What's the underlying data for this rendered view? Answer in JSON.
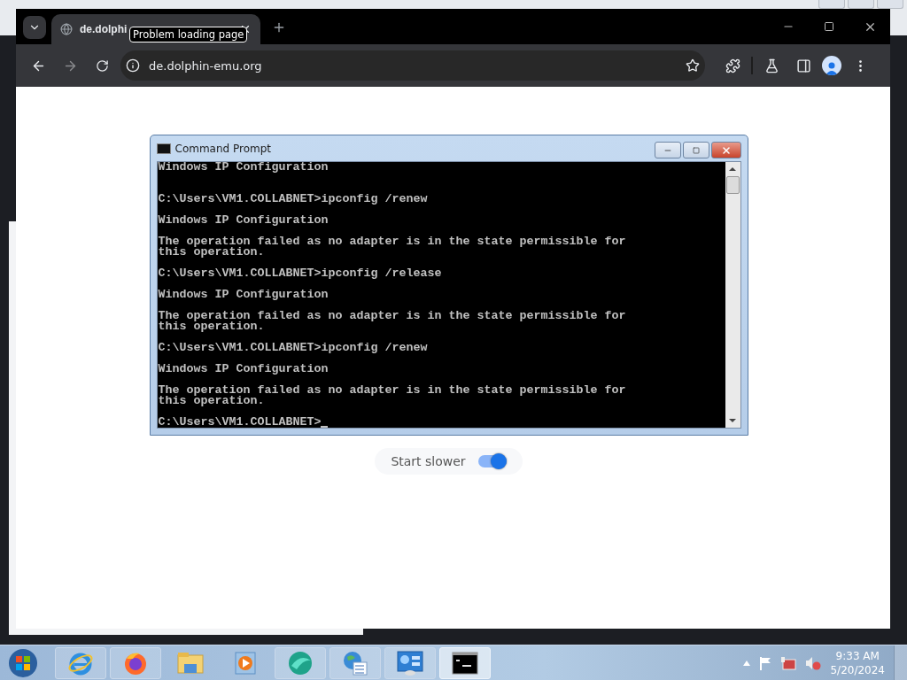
{
  "browser": {
    "tabs": [
      {
        "title": "de.dolphi",
        "selected": true
      }
    ],
    "tooltip": "Problem loading page",
    "address": "de.dolphin-emu.org"
  },
  "console": {
    "title": "Command Prompt",
    "blocks": [
      {
        "lines": [
          "Windows IP Configuration"
        ]
      },
      {
        "lines": [
          "C:\\Users\\VM1.COLLABNET>ipconfig /renew"
        ]
      },
      {
        "lines": [
          "Windows IP Configuration"
        ]
      },
      {
        "lines": [
          "The operation failed as no adapter is in the state permissible for",
          "this operation."
        ]
      },
      {
        "lines": [
          "C:\\Users\\VM1.COLLABNET>ipconfig /release"
        ]
      },
      {
        "lines": [
          "Windows IP Configuration"
        ]
      },
      {
        "lines": [
          "The operation failed as no adapter is in the state permissible for",
          "this operation."
        ]
      },
      {
        "lines": [
          "C:\\Users\\VM1.COLLABNET>ipconfig /renew"
        ]
      },
      {
        "lines": [
          "Windows IP Configuration"
        ]
      },
      {
        "lines": [
          "The operation failed as no adapter is in the state permissible for",
          "this operation."
        ]
      }
    ],
    "prompt": "C:\\Users\\VM1.COLLABNET>"
  },
  "toggle": {
    "label": "Start slower",
    "on": true
  },
  "taskbar": {
    "apps": [
      {
        "kind": "ie",
        "selected": false
      },
      {
        "kind": "firefox",
        "selected": false
      },
      {
        "kind": "folder",
        "selected": false
      },
      {
        "kind": "media",
        "selected": false
      },
      {
        "kind": "chat",
        "selected": false
      },
      {
        "kind": "globe",
        "selected": false
      },
      {
        "kind": "control",
        "selected": false
      },
      {
        "kind": "console",
        "selected": true
      }
    ],
    "time": "9:33 AM",
    "date": "5/20/2024"
  }
}
